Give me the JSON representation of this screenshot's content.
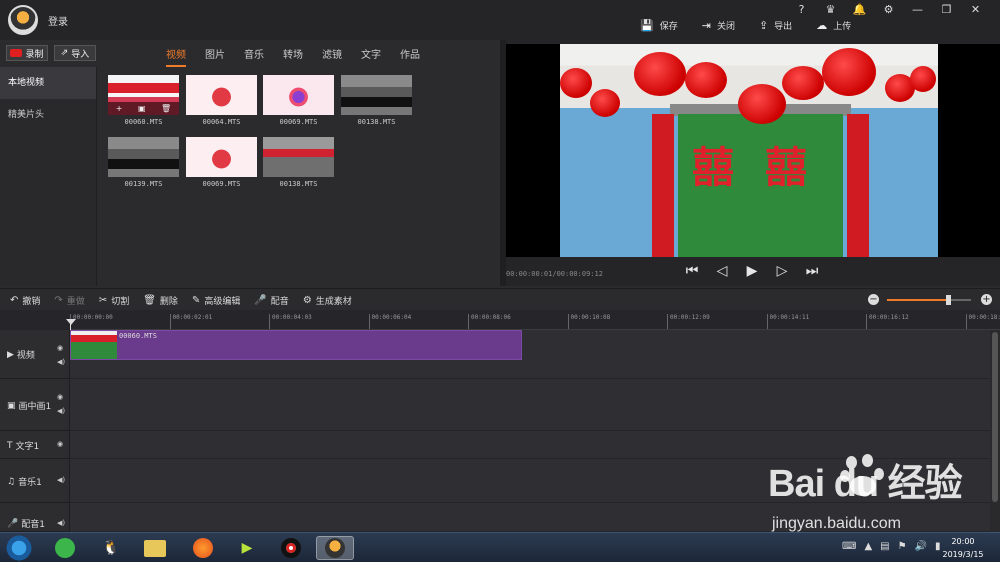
{
  "app": {
    "login_label": "登录",
    "window_controls": [
      "?",
      "♛",
      "🔔",
      "⚙",
      "—",
      "❐",
      "✕"
    ],
    "actions": [
      {
        "icon": "save-icon",
        "glyph": "💾",
        "label": "保存"
      },
      {
        "icon": "close-icon",
        "glyph": "⇥",
        "label": "关闭"
      },
      {
        "icon": "export-icon",
        "glyph": "⇪",
        "label": "导出"
      },
      {
        "icon": "upload-icon",
        "glyph": "☁",
        "label": "上传"
      }
    ]
  },
  "library": {
    "record_label": "录制",
    "import_label": "导入",
    "tabs": [
      "视频",
      "图片",
      "音乐",
      "转场",
      "滤镜",
      "文字",
      "作品"
    ],
    "active_tab": "视频",
    "sidebar": [
      "本地视频",
      "精美片头"
    ],
    "thumbnails": [
      {
        "name": "00060.MTS",
        "style": "t-red"
      },
      {
        "name": "00064.MTS",
        "style": "t-xi"
      },
      {
        "name": "00069.MTS",
        "style": "t-xi2"
      },
      {
        "name": "00138.MTS",
        "style": "t-car"
      },
      {
        "name": "00139.MTS",
        "style": "t-car"
      },
      {
        "name": "00069.MTS",
        "style": "t-xi"
      },
      {
        "name": "00138.MTS",
        "style": "t-red2"
      }
    ]
  },
  "preview": {
    "timecode": "00:00:00:01/00:00:09:12",
    "xi_char": "囍"
  },
  "toolbar": {
    "tools": [
      {
        "icon": "undo-icon",
        "glyph": "↶",
        "label": "撤销",
        "enabled": true
      },
      {
        "icon": "redo-icon",
        "glyph": "↷",
        "label": "重做",
        "enabled": false
      },
      {
        "icon": "cut-icon",
        "glyph": "✂",
        "label": "切割",
        "enabled": true
      },
      {
        "icon": "delete-icon",
        "glyph": "🗑",
        "label": "删除",
        "enabled": true
      },
      {
        "icon": "advanced-edit-icon",
        "glyph": "✎",
        "label": "高级编辑",
        "enabled": true
      },
      {
        "icon": "mic-icon",
        "glyph": "🎤",
        "label": "配音",
        "enabled": true
      },
      {
        "icon": "material-icon",
        "glyph": "⚙",
        "label": "生成素材",
        "enabled": true
      }
    ],
    "zoom_minus": "−",
    "zoom_plus": "+",
    "zoom_level": 0.73
  },
  "ruler": {
    "ticks": [
      "00:00:00:00",
      "00:00:02:01",
      "00:00:04:03",
      "00:00:06:04",
      "00:00:08:06",
      "00:00:10:08",
      "00:00:12:09",
      "00:00:14:11",
      "00:00:16:12",
      "00:00:18:"
    ]
  },
  "tracks": [
    {
      "icon": "video-track-icon",
      "glyph": "▶",
      "label": "视频"
    },
    {
      "icon": "pip-track-icon",
      "glyph": "▣",
      "label": "画中画1"
    },
    {
      "icon": "text-track-icon",
      "glyph": "T",
      "label": "文字1"
    },
    {
      "icon": "music-track-icon",
      "glyph": "♫",
      "label": "音乐1"
    },
    {
      "icon": "dub-track-icon",
      "glyph": "🎤",
      "label": "配音1"
    }
  ],
  "clip": {
    "name": "00060.MTS"
  },
  "taskbar": {
    "time": "20:00",
    "date": "2019/3/15"
  },
  "watermark": {
    "main": "Bai  du 经验",
    "sub": "jingyan.baidu.com"
  }
}
